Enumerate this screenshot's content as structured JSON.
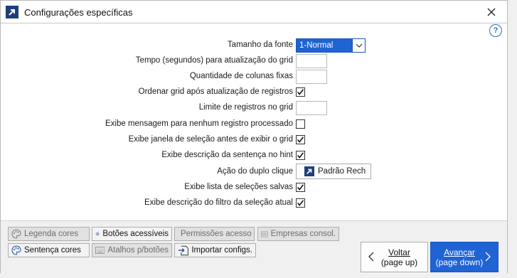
{
  "window": {
    "title": "Configurações específicas",
    "app_icon": "arrow-up-right-icon",
    "close_icon": "close-icon",
    "help_label": "?"
  },
  "settings": {
    "font_size_label": "Tamanho da fonte",
    "font_size_value": "1-Normal",
    "refresh_time_label": "Tempo (segundos) para atualização do grid",
    "refresh_time_value": "",
    "fixed_columns_label": "Quantidade de colunas fixas",
    "fixed_columns_value": "",
    "sort_grid_label": "Ordenar grid após atualização de registros",
    "sort_grid_checked": true,
    "record_limit_label": "Limite de registros no grid",
    "record_limit_value": "",
    "no_record_msg_label": "Exibe mensagem para nenhum registro processado",
    "no_record_msg_checked": false,
    "selection_window_label": "Exibe janela de seleção antes de exibir o grid",
    "selection_window_checked": true,
    "hint_label": "Exibe descrição da sentença no hint",
    "hint_checked": true,
    "double_click_label": "Ação do duplo clique",
    "double_click_value": "Padrão Rech",
    "saved_selections_label": "Exibe lista de seleções salvas",
    "saved_selections_checked": true,
    "filter_desc_label": "Exibe descrição do filtro da seleção atual",
    "filter_desc_checked": true
  },
  "toolbar": {
    "legend_colors": "Legenda cores",
    "accessible_buttons": "Botões acessíveis",
    "access_permissions": "Permissões acesso",
    "consolidated_companies": "Empresas consol.",
    "sentence_colors": "Sentença cores",
    "button_shortcuts": "Atalhos p/botões",
    "import_configs": "Importar configs."
  },
  "navigation": {
    "back_label": "Voltar",
    "back_sub": "(page up)",
    "next_label": "Avançar",
    "next_sub": "(page down)"
  },
  "colors": {
    "accent": "#1f63d4",
    "brand_icon": "#1f3f7a",
    "help": "#2a6fc9"
  }
}
